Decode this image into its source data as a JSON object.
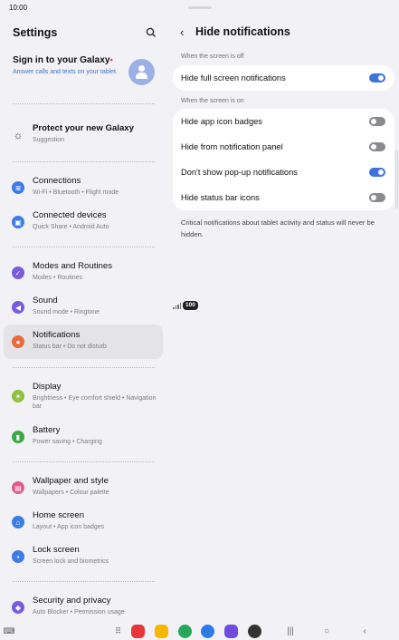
{
  "status": {
    "time": "10:00",
    "battery": "100"
  },
  "settings": {
    "title": "Settings",
    "account": {
      "title": "Sign in to your Galaxy",
      "subtitle": "Answer calls and texts on your tablet."
    },
    "items": [
      {
        "title": "Protect your new Galaxy",
        "sub": "Suggestion",
        "icon": "suggestion-icon",
        "color": ""
      },
      {
        "title": "Connections",
        "sub": "Wi-Fi  •  Bluetooth  •  Flight mode",
        "icon": "wifi-icon",
        "color": "#3c7be8"
      },
      {
        "title": "Connected devices",
        "sub": "Quick Share  •  Android Auto",
        "icon": "devices-icon",
        "color": "#3c7be8"
      },
      {
        "title": "Modes and Routines",
        "sub": "Modes  •  Routines",
        "icon": "modes-icon",
        "color": "#7a5ae0"
      },
      {
        "title": "Sound",
        "sub": "Sound mode  •  Ringtone",
        "icon": "sound-icon",
        "color": "#7a5ae0"
      },
      {
        "title": "Notifications",
        "sub": "Status bar  •  Do not disturb",
        "icon": "bell-icon",
        "color": "#e76a38"
      },
      {
        "title": "Display",
        "sub": "Brightness  •  Eye comfort shield  •  Navigation bar",
        "icon": "brightness-icon",
        "color": "#8dc23c"
      },
      {
        "title": "Battery",
        "sub": "Power saving  •  Charging",
        "icon": "battery-icon",
        "color": "#3ca845"
      },
      {
        "title": "Wallpaper and style",
        "sub": "Wallpapers  •  Colour palette",
        "icon": "palette-icon",
        "color": "#e35a8c"
      },
      {
        "title": "Home screen",
        "sub": "Layout  •  App icon badges",
        "icon": "home-icon",
        "color": "#3c7be8"
      },
      {
        "title": "Lock screen",
        "sub": "Screen lock and biometrics",
        "icon": "lock-icon",
        "color": "#3c7be8"
      },
      {
        "title": "Security and privacy",
        "sub": "Auto Blocker  •  Permission usage",
        "icon": "shield-icon",
        "color": "#7a5ae0"
      }
    ]
  },
  "detail": {
    "title": "Hide notifications",
    "section_off": "When the screen is off",
    "section_on": "When the screen is on",
    "rows_off": [
      {
        "label": "Hide full screen notifications",
        "on": true
      }
    ],
    "rows_on": [
      {
        "label": "Hide app icon badges",
        "on": false
      },
      {
        "label": "Hide from notification panel",
        "on": false
      },
      {
        "label": "Don't show pop-up notifications",
        "on": true
      },
      {
        "label": "Hide status bar icons",
        "on": false
      }
    ],
    "note": "Critical notifications about tablet activity and status will never be hidden."
  },
  "colors": {
    "accent": "#3d73db",
    "toggle_off": "#8a8a8f",
    "active_bg": "#e4e4e8"
  }
}
